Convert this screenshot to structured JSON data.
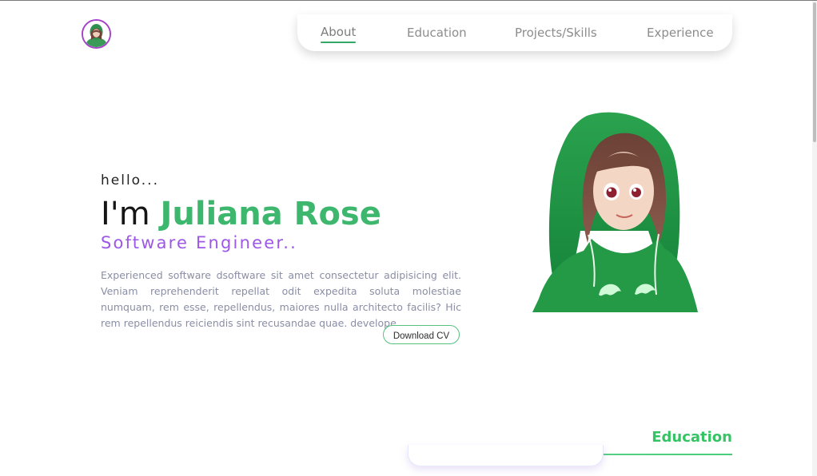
{
  "nav": {
    "items": [
      {
        "label": "About",
        "active": true
      },
      {
        "label": "Education",
        "active": false
      },
      {
        "label": "Projects/Skills",
        "active": false
      },
      {
        "label": "Experience",
        "active": false
      }
    ]
  },
  "hero": {
    "greeting": "hello...",
    "headline_prefix": "I'm",
    "name": "Juliana Rose",
    "role": "Software Engineer..",
    "description": "Experienced software dsoftware sit amet consectetur adipisicing elit. Veniam reprehenderit repellat odit expedita soluta molestiae numquam, rem esse, repellendus, maiores nulla architecto facilis? Hic rem repellendus reiciendis sint recusandae quae. develope",
    "cta_label": "Download CV"
  },
  "sections": {
    "education_title": "Education"
  },
  "colors": {
    "accent_green": "#3eb76e",
    "accent_purple": "#9d58e7",
    "text_dark": "#151515",
    "text_muted": "#8a8ea4"
  },
  "icons": {
    "logo": "avatar-logo-icon",
    "hero": "girl-in-hoodie-illustration"
  }
}
